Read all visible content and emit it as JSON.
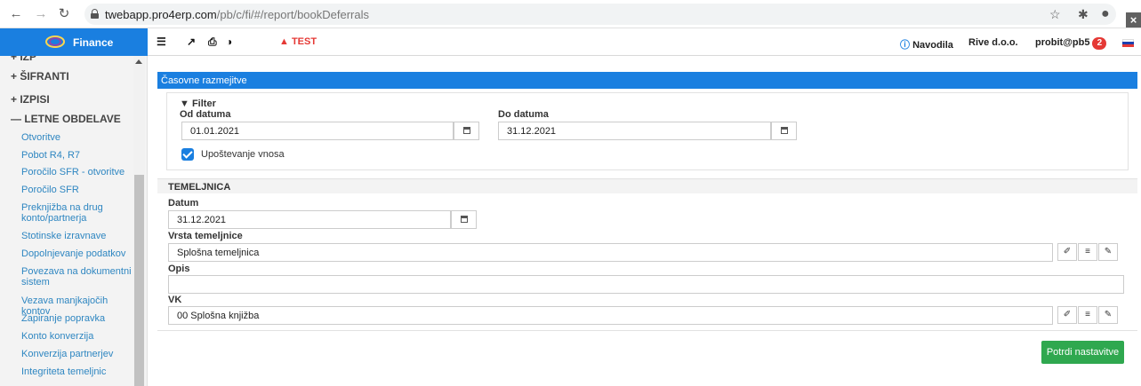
{
  "browser": {
    "url_host": "twebapp.pro4erp.com",
    "url_path": "/pb/c/fi/#/report/bookDeferrals"
  },
  "app": {
    "brand": "Finance",
    "test_label": "TEST",
    "help_label": "Navodila",
    "company": "Rive d.o.o.",
    "user": "probit@pb5",
    "notifications": "2"
  },
  "sidebar": {
    "sections": {
      "sifranti": "+ ŠIFRANTI",
      "izpisi": "+ IZPISI",
      "letne": "— LETNE OBDELAVE"
    },
    "items": [
      "Otvoritve",
      "Pobot R4, R7",
      "Poročilo SFR - otvoritve",
      "Poročilo SFR",
      "Preknjižba na drug konto/partnerja",
      "Stotinske izravnave",
      "Dopolnjevanje podatkov",
      "Povezava na dokumentni sistem",
      "Vezava manjkajočih kontov",
      "Zapiranje popravka",
      "Konto konverzija",
      "Konverzija partnerjev",
      "Integriteta temeljnic"
    ]
  },
  "panel": {
    "title": "Časovne razmejitve",
    "filter": {
      "label": "Filter",
      "from_label": "Od datuma",
      "from_value": "01.01.2021",
      "to_label": "Do datuma",
      "to_value": "31.12.2021",
      "checkbox_label": "Upoštevanje vnosa",
      "checkbox_checked": true
    },
    "temeljnica": {
      "section_title": "TEMELJNICA",
      "datum_label": "Datum",
      "datum_value": "31.12.2021",
      "vrsta_label": "Vrsta temeljnice",
      "vrsta_value": "Splošna temeljnica",
      "opis_label": "Opis",
      "opis_value": "",
      "vk_label": "VK",
      "vk_value": "00 Splošna knjižba"
    },
    "confirm_label": "Potrdi nastavitve"
  }
}
